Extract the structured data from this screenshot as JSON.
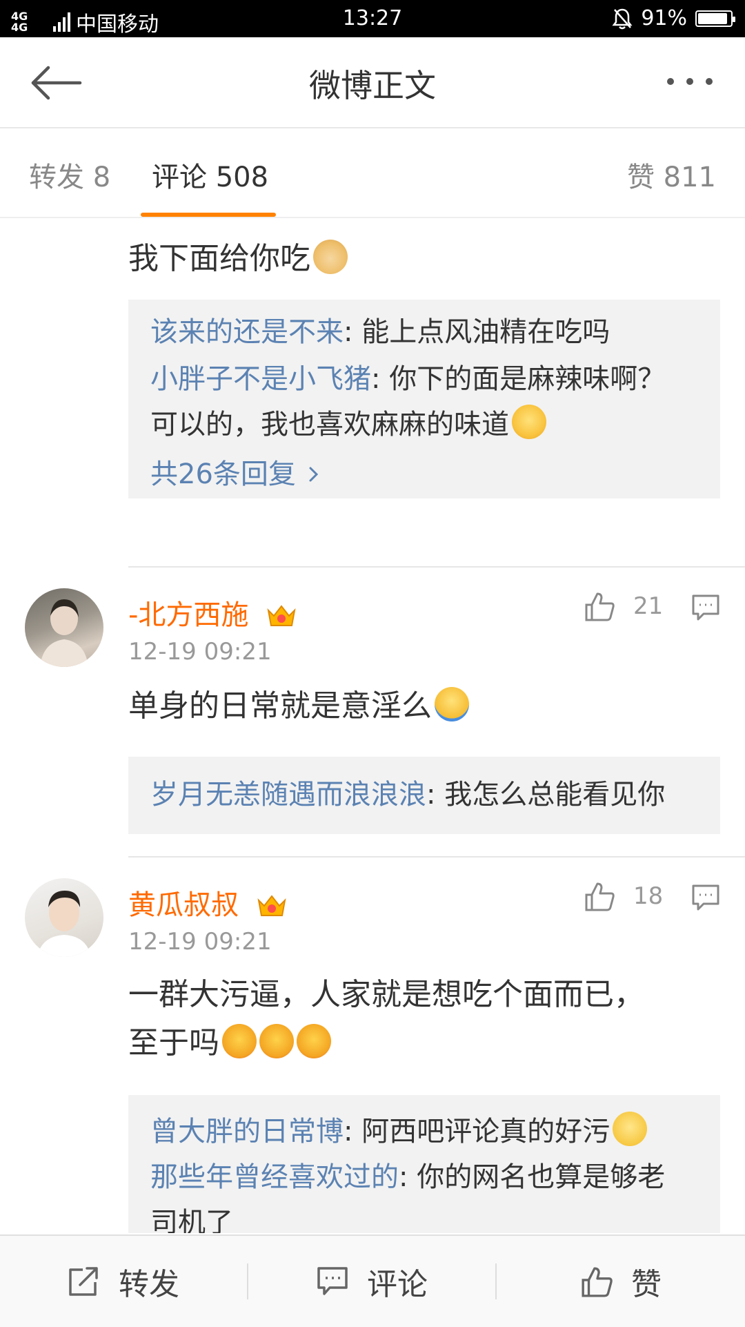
{
  "status_bar": {
    "network": "4G 4G",
    "carrier": "中国移动",
    "time": "13:27",
    "battery": "91%",
    "battery_level": 0.91
  },
  "navbar": {
    "title": "微博正文"
  },
  "tabs": [
    {
      "label": "转发 8"
    },
    {
      "label": "评论 508"
    },
    {
      "label": "赞 811"
    }
  ],
  "comments": [
    {
      "text": "我下面给你吃",
      "emoji": "doge-emoji",
      "replies": [
        {
          "nick": "该来的还是不来",
          "text": ": 能上点风油精在吃吗"
        },
        {
          "nick": "小胖子不是小飞猪",
          "text": ": 你下的面是麻辣味啊？"
        },
        {
          "nick": "",
          "text": "可以的，我也喜欢麻麻的味道"
        }
      ],
      "more_replies": "共26条回复"
    },
    {
      "author": "-北方西施",
      "time": "12-19 09:21",
      "likes": "21",
      "text": "单身的日常就是意淫么",
      "emoji": "shrug-emoji",
      "replies": [
        {
          "nick": "岁月无恙随遇而浪浪浪",
          "text": ": 我怎么总能看见你"
        }
      ]
    },
    {
      "author": "黄瓜叔叔",
      "time": "12-19 09:21",
      "likes": "18",
      "text_line1": "一群大污逼，人家就是想吃个面而已，",
      "text_line2": "至于吗",
      "emoji": "angry-emoji",
      "replies": [
        {
          "nick": "曾大胖的日常博",
          "text": ": 阿西吧评论真的好污"
        },
        {
          "nick": "那些年曾经喜欢过的",
          "text": ": 你的网名也算是够老"
        },
        {
          "nick": "",
          "text": "司机了"
        }
      ]
    }
  ],
  "bottom_bar": {
    "repost": "转发",
    "comment": "评论",
    "like": "赞"
  },
  "colors": {
    "accent": "#ff8200",
    "nick": "#5b82b2",
    "author": "#ff6a00"
  }
}
